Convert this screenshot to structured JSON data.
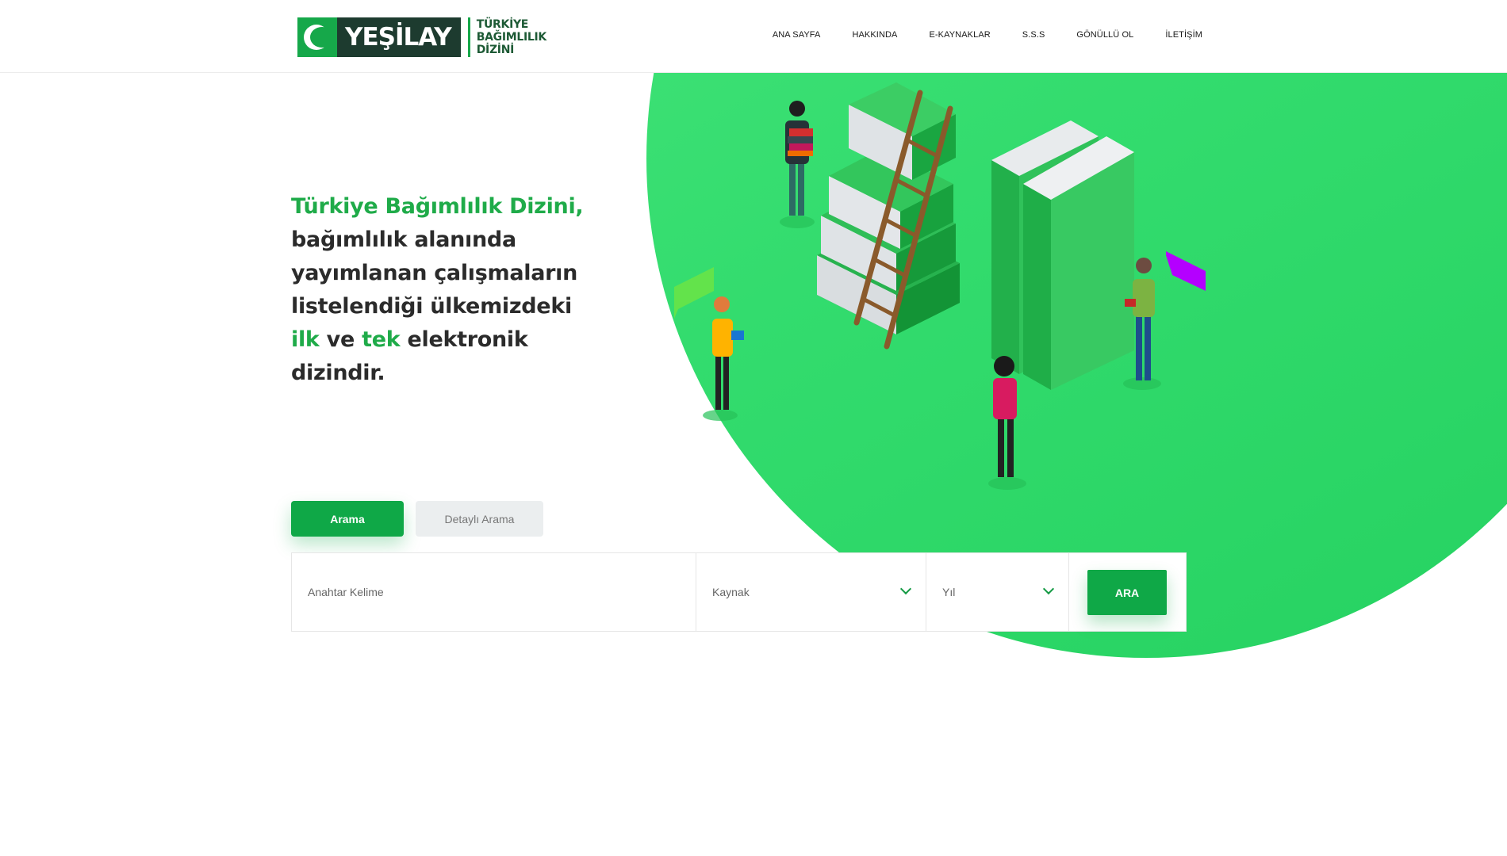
{
  "brand": {
    "word": "YEŞİLAY",
    "sub_line1": "TÜRKİYE",
    "sub_line2": "BAĞIMLILIK",
    "sub_line3": "DİZİNİ",
    "color_green": "#16a84a",
    "color_dark": "#1d3b2f"
  },
  "nav": {
    "items": [
      "ANA SAYFA",
      "HAKKINDA",
      "E-KAYNAKLAR",
      "S.S.S",
      "GÖNÜLLÜ OL",
      "İLETİŞİM"
    ]
  },
  "hero": {
    "line1": "Türkiye Bağımlılık Dizini,",
    "line2": "bağımlılık alanında",
    "line3": "yayımlanan çalışmaların",
    "line4": "listelendiği ülkemizdeki",
    "word_ilk": "ilk",
    "word_ve": " ve ",
    "word_tek": "tek",
    "word_elektronik": " elektronik",
    "line6": "dizindir."
  },
  "tabs": {
    "search": "Arama",
    "advanced": "Detaylı Arama"
  },
  "search": {
    "keyword_placeholder": "Anahtar Kelime",
    "source_placeholder": "Kaynak",
    "year_placeholder": "Yıl",
    "button_label": "ARA"
  },
  "colors": {
    "accent": "#0fa847",
    "blob": "#33dc6e",
    "text": "#2b2b2b"
  }
}
